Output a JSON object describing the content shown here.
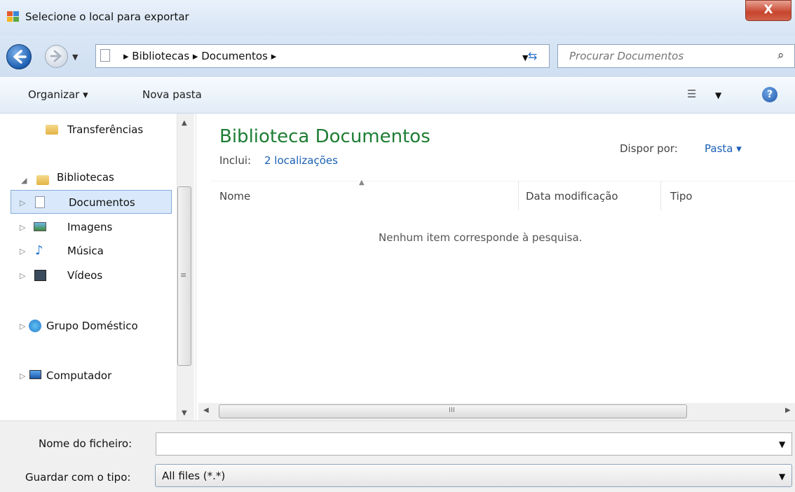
{
  "window": {
    "title": "Selecione o local para exportar",
    "close_glyph": "X"
  },
  "address_bar": {
    "path": [
      "Bibliotecas",
      "Documentos"
    ],
    "path_display": "▸ Bibliotecas ▸ Documentos ▸",
    "search_placeholder": "Procurar Documentos"
  },
  "toolbar": {
    "organize_label": "Organizar ▾",
    "new_folder_label": "Nova pasta",
    "help_glyph": "?"
  },
  "nav_pane": {
    "items": [
      {
        "label": "Transferências",
        "icon": "downloads-folder-icon"
      },
      {
        "label": "Bibliotecas",
        "icon": "libraries-folder-icon",
        "expanded": true
      },
      {
        "label": "Documentos",
        "icon": "documents-icon",
        "selected": true
      },
      {
        "label": "Imagens",
        "icon": "pictures-icon"
      },
      {
        "label": "Música",
        "icon": "music-icon"
      },
      {
        "label": "Vídeos",
        "icon": "videos-icon"
      },
      {
        "label": "Grupo Doméstico",
        "icon": "homegroup-icon"
      },
      {
        "label": "Computador",
        "icon": "computer-icon"
      }
    ]
  },
  "content": {
    "library_title": "Biblioteca Documentos",
    "includes_label": "Inclui:",
    "includes_link": "2 localizações",
    "arrange_label": "Dispor por:",
    "arrange_value": "Pasta ▾",
    "columns": [
      "Nome",
      "Data modificação",
      "Tipo"
    ],
    "empty_message": "Nenhum item corresponde à pesquisa."
  },
  "form": {
    "filename_label": "Nome do ficheiro:",
    "filename_value": "",
    "filetype_label": "Guardar com o tipo:",
    "filetype_value": "All files (*.*)"
  },
  "colors": {
    "accent_green": "#1e7e34",
    "link_blue": "#1a5fb4",
    "selection": "#d9e9fb"
  }
}
